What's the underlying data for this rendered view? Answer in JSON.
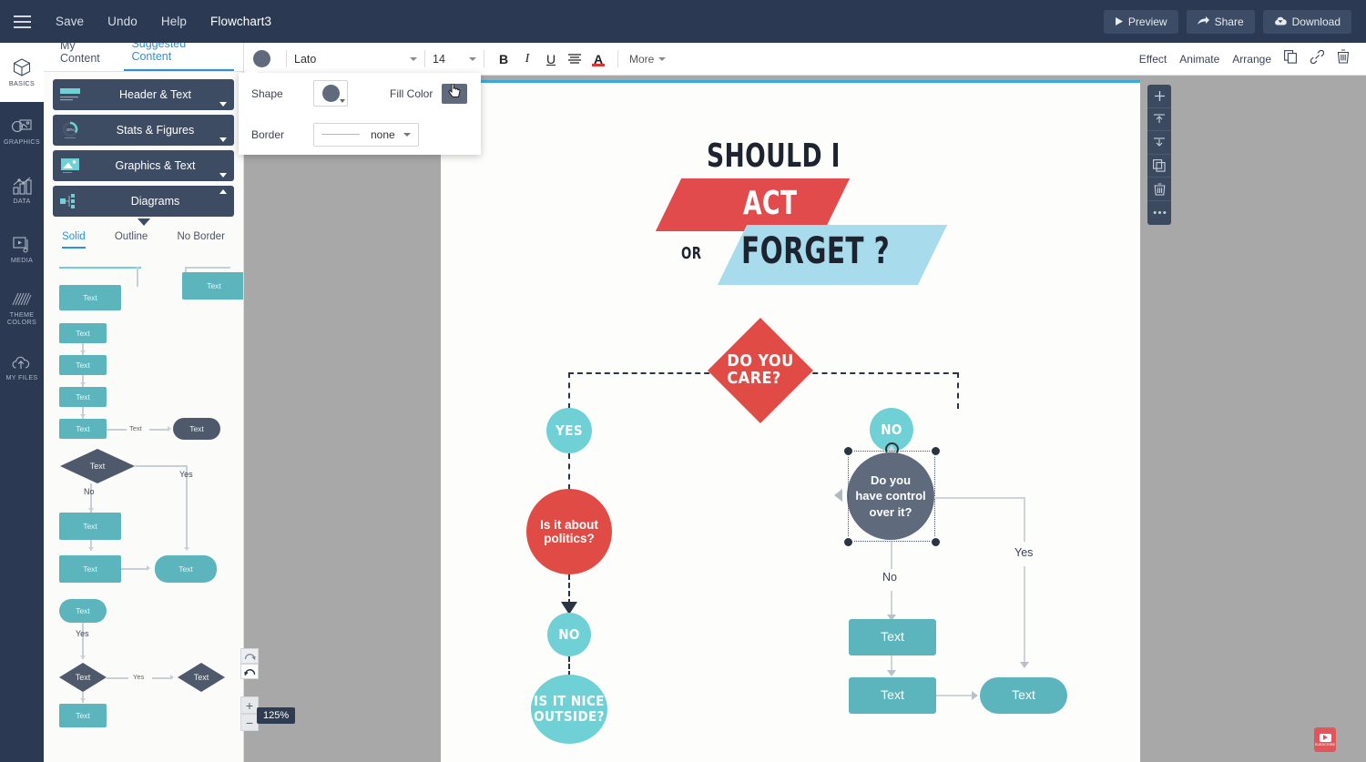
{
  "topbar": {
    "menu_icon": "hamburger-icon",
    "items": [
      "Save",
      "Undo",
      "Help"
    ],
    "document_title": "Flowchart3",
    "actions": [
      {
        "label": "Preview",
        "icon": "play-icon"
      },
      {
        "label": "Share",
        "icon": "share-arrow-icon"
      },
      {
        "label": "Download",
        "icon": "cloud-download-icon"
      }
    ]
  },
  "rail": {
    "items": [
      {
        "label": "BASICS",
        "icon": "cube-icon",
        "active": true
      },
      {
        "label": "GRAPHICS",
        "icon": "image-shapes-icon",
        "active": false
      },
      {
        "label": "DATA",
        "icon": "bar-chart-icon",
        "active": false
      },
      {
        "label": "MEDIA",
        "icon": "video-play-icon",
        "active": false
      },
      {
        "label": "THEME COLORS",
        "icon": "color-lines-icon",
        "active": false
      },
      {
        "label": "MY FILES",
        "icon": "cloud-upload-icon",
        "active": false
      }
    ]
  },
  "panel": {
    "tabs": [
      {
        "label": "My Content",
        "active": false
      },
      {
        "label": "Suggested Content",
        "active": true
      }
    ],
    "accordion": [
      {
        "label": "Header & Text",
        "open": false,
        "thumb": "header-text-thumb"
      },
      {
        "label": "Stats & Figures",
        "open": false,
        "thumb": "donut-40-thumb",
        "thumb_value": "40%"
      },
      {
        "label": "Graphics & Text",
        "open": false,
        "thumb": "picture-thumb"
      },
      {
        "label": "Diagrams",
        "open": true,
        "thumb": "diagram-nodes-thumb"
      }
    ],
    "subtabs": [
      {
        "label": "Solid",
        "active": true
      },
      {
        "label": "Outline",
        "active": false
      },
      {
        "label": "No Border",
        "active": false
      }
    ],
    "templates": {
      "node_text": "Text",
      "yes_label": "Yes",
      "no_label": "No"
    }
  },
  "format_toolbar": {
    "fill_swatch_color": "#5f6b7d",
    "font_family": "Lato",
    "font_size": "14",
    "buttons": [
      {
        "name": "bold-button",
        "glyph": "B"
      },
      {
        "name": "italic-button",
        "glyph": "I"
      },
      {
        "name": "underline-button",
        "glyph": "U"
      },
      {
        "name": "align-button",
        "glyph": "align-lines-icon"
      },
      {
        "name": "text-color-button",
        "glyph": "A"
      }
    ],
    "more_label": "More",
    "right_actions": [
      "Effect",
      "Animate",
      "Arrange"
    ],
    "right_icons": [
      "duplicate-icon",
      "link-icon",
      "trash-icon"
    ]
  },
  "shape_popup": {
    "shape_label": "Shape",
    "shape_value": "circle",
    "fill_color_label": "Fill Color",
    "fill_color_value": "#5f6b7d",
    "border_label": "Border",
    "border_value": "none"
  },
  "object_toolbar": {
    "buttons": [
      {
        "name": "add-icon",
        "title": "add"
      },
      {
        "name": "bring-to-front-icon",
        "title": "bring to front"
      },
      {
        "name": "send-to-back-icon",
        "title": "send to back"
      },
      {
        "name": "duplicate-icon",
        "title": "duplicate"
      },
      {
        "name": "trash-icon",
        "title": "delete"
      },
      {
        "name": "more-dots-icon",
        "title": "more"
      }
    ]
  },
  "zoom_controls": {
    "redo_icon": "redo-arrow-icon",
    "undo_icon": "undo-arrow-icon",
    "zoom_in": "+",
    "zoom_out": "−",
    "zoom_level": "125%"
  },
  "subscribe_badge": {
    "label": "SUBSCRIBE",
    "color": "#e2555a"
  },
  "canvas": {
    "title_art": {
      "line1": "SHOULD I",
      "line2": "ACT",
      "line3_small": "OR",
      "line3": "FORGET ?",
      "red_color": "#e14b4b",
      "blue_color": "#a8dcec"
    },
    "flow": {
      "decision_main": "DO YOU\nCARE?",
      "yes_node": "YES",
      "politics_node": "Is it about\npolitics?",
      "no_node_left": "NO",
      "nice_outside_node": "IS IT NICE\nOUTSIDE?",
      "no_node_right": "NO",
      "selected_node": "Do you\nhave control\nover it?",
      "label_no": "No",
      "label_yes": "Yes",
      "placeholder_text": "Text",
      "colors": {
        "red": "#e04b45",
        "teal": "#6fd0d6",
        "gray": "#5f6b7d",
        "teal_dark": "#5cb4bd"
      }
    }
  }
}
